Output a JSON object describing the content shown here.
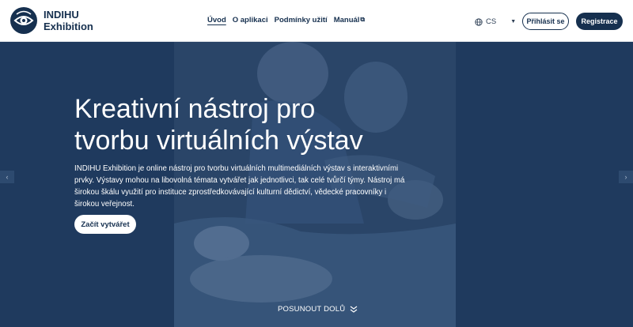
{
  "brand": {
    "line1": "INDIHU",
    "line2": "Exhibition"
  },
  "nav": [
    {
      "label": "Úvod",
      "active": true
    },
    {
      "label": "O aplikaci"
    },
    {
      "label": "Podmínky užití"
    },
    {
      "label": "Manuál"
    }
  ],
  "language": {
    "code": "CS"
  },
  "auth": {
    "login": "Přihlásit se",
    "register": "Registrace"
  },
  "hero": {
    "title_line1": "Kreativní nástroj pro",
    "title_line2": "tvorbu virtuálních výstav",
    "description": "INDIHU Exhibition je online nástroj pro tvorbu virtuálních multimediálních výstav s interaktivními prvky. Výstavy mohou na libovolná témata vytvářet jak jednotlivci, tak celé tvůrčí týmy. Nástroj má širokou škálu využití pro instituce zprostředkovávající kulturní dědictví, vědecké pracovníky i širokou veřejnost.",
    "cta": "Začít vytvářet",
    "scroll_down": "POSUNOUT DOLŮ"
  },
  "colors": {
    "primary": "#16304f",
    "hero_bg": "#1f3a5e",
    "white": "#ffffff"
  },
  "icons": {
    "logo": "eye-logo-icon",
    "globe": "globe-icon",
    "external": "external-link-icon",
    "chevron": "chevron-down-icon"
  }
}
